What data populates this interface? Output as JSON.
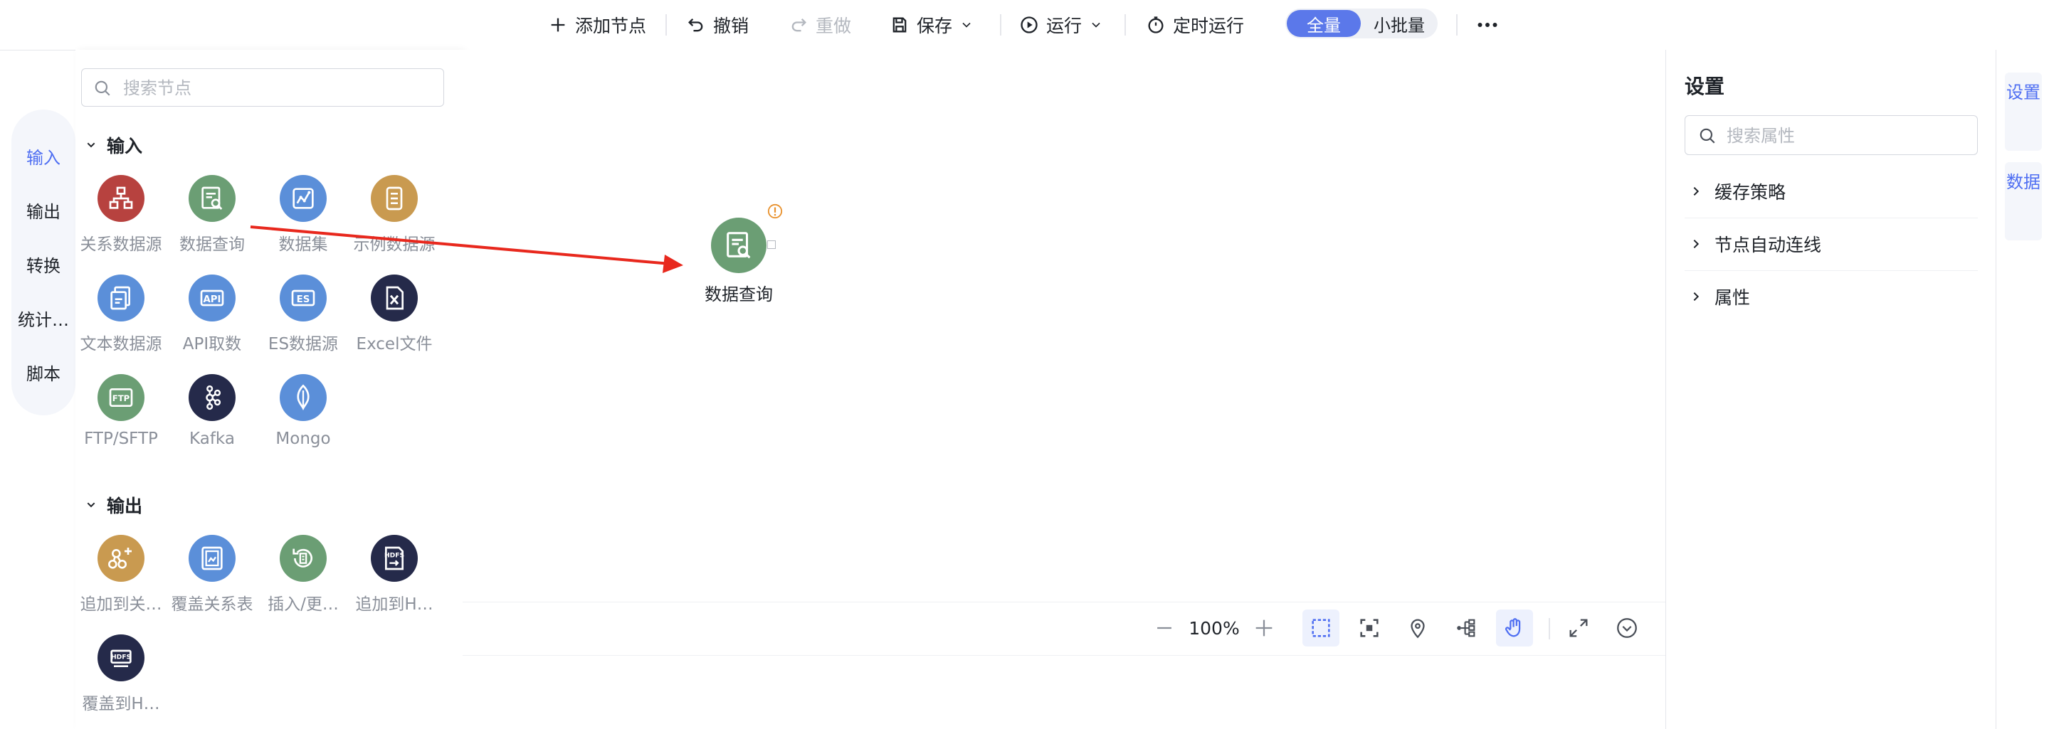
{
  "toolbar": {
    "add_node": "添加节点",
    "undo": "撤销",
    "redo": "重做",
    "save": "保存",
    "run": "运行",
    "scheduled_run": "定时运行",
    "scope_full": "全量",
    "scope_batch": "小批量"
  },
  "categories": [
    {
      "label": "输入",
      "active": true
    },
    {
      "label": "输出",
      "active": false
    },
    {
      "label": "转换",
      "active": false
    },
    {
      "label": "统计…",
      "active": false
    },
    {
      "label": "脚本",
      "active": false
    }
  ],
  "node_panel": {
    "search_placeholder": "搜索节点",
    "sections": [
      {
        "title": "输入",
        "nodes": [
          {
            "label": "关系数据源",
            "icon": "relational-db-icon",
            "color": "#b7423f"
          },
          {
            "label": "数据查询",
            "icon": "data-query-icon",
            "color": "#6b9e74"
          },
          {
            "label": "数据集",
            "icon": "dataset-icon",
            "color": "#5b8fd9"
          },
          {
            "label": "示例数据源",
            "icon": "sample-data-icon",
            "color": "#c99a50"
          },
          {
            "label": "文本数据源",
            "icon": "text-file-icon",
            "color": "#5b8fd9"
          },
          {
            "label": "API取数",
            "icon": "api-icon",
            "color": "#5b8fd9"
          },
          {
            "label": "ES数据源",
            "icon": "es-icon",
            "color": "#5b8fd9"
          },
          {
            "label": "Excel文件",
            "icon": "excel-icon",
            "color": "#252a4a"
          },
          {
            "label": "FTP/SFTP",
            "icon": "ftp-icon",
            "color": "#6b9e74"
          },
          {
            "label": "Kafka",
            "icon": "kafka-icon",
            "color": "#252a4a"
          },
          {
            "label": "Mongo",
            "icon": "mongo-icon",
            "color": "#5b8fd9"
          }
        ]
      },
      {
        "title": "输出",
        "nodes": [
          {
            "label": "追加到关…",
            "icon": "append-relational-icon",
            "color": "#c99a50"
          },
          {
            "label": "覆盖关系表",
            "icon": "overwrite-table-icon",
            "color": "#5b8fd9"
          },
          {
            "label": "插入/更…",
            "icon": "upsert-icon",
            "color": "#6b9e74"
          },
          {
            "label": "追加到H…",
            "icon": "hdfs-append-icon",
            "color": "#252a4a"
          },
          {
            "label": "覆盖到H…",
            "icon": "hdfs-overwrite-icon",
            "color": "#252a4a"
          }
        ]
      }
    ]
  },
  "canvas": {
    "node_label": "数据查询",
    "zoom": "100%"
  },
  "settings": {
    "title": "设置",
    "search_placeholder": "搜索属性",
    "sections": [
      "缓存策略",
      "节点自动连线",
      "属性"
    ]
  },
  "side_tabs": [
    "设置",
    "数据"
  ],
  "colors": {
    "accent": "#4e6ef2",
    "toggle_active": "#5b78ea",
    "arrow": "#e8281d"
  }
}
